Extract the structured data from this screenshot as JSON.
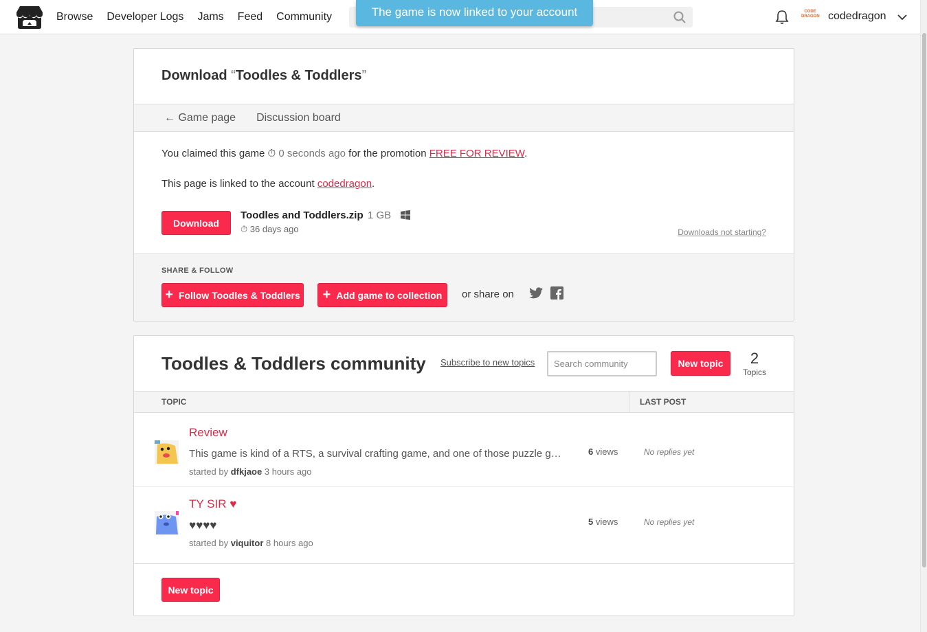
{
  "header": {
    "nav": [
      "Browse",
      "Developer Logs",
      "Jams",
      "Feed",
      "Community"
    ],
    "toast": "The game is now linked to your account",
    "username": "codedragon",
    "avatar_text": "CODE DRAGON"
  },
  "download": {
    "title_prefix": "Download ",
    "quote_open": "“",
    "game_name": "Toodles & Toddlers",
    "quote_close": "”",
    "subnav": {
      "back": "Game page",
      "discussion": "Discussion board"
    },
    "claim": {
      "prefix": "You claimed this game",
      "ago": "0 seconds ago",
      "middle": "for the promotion",
      "promo": "FREE FOR REVIEW",
      "suffix": "."
    },
    "linked": {
      "prefix": "This page is linked to the account",
      "account": "codedragon",
      "suffix": "."
    },
    "download_label": "Download",
    "file": {
      "name": "Toodles and Toddlers.zip",
      "size": "1 GB",
      "date": "36 days ago"
    },
    "not_starting": "Downloads not starting?"
  },
  "share": {
    "label": "SHARE & FOLLOW",
    "follow": "Follow Toodles & Toddlers",
    "collection": "Add game to collection",
    "share_on": "or share on"
  },
  "community": {
    "title": "Toodles & Toddlers community",
    "subscribe": "Subscribe to new topics",
    "search_placeholder": "Search community",
    "new_topic": "New topic",
    "topic_count": "2",
    "topic_count_label": "Topics",
    "col_topic": "TOPIC",
    "col_last": "LAST POST",
    "topics": [
      {
        "title": "Review",
        "body": "This game is kind of a RTS, a survival crafting game, and one of those puzzle games where you have to pick the right combination to win",
        "started_by": "started by",
        "author": "dfkjaoe",
        "ago": "3 hours ago",
        "views": "6",
        "views_label": "views",
        "last": "No replies yet"
      },
      {
        "title": "TY SIR ♥",
        "body": "♥♥♥♥",
        "started_by": "started by",
        "author": "viquitor",
        "ago": "8 hours ago",
        "views": "5",
        "views_label": "views",
        "last": "No replies yet"
      }
    ],
    "new_topic_bottom": "New topic"
  },
  "colors": {
    "accent": "#fa2a4d",
    "link": "#da2c49",
    "toast": "#5ab8e0"
  }
}
